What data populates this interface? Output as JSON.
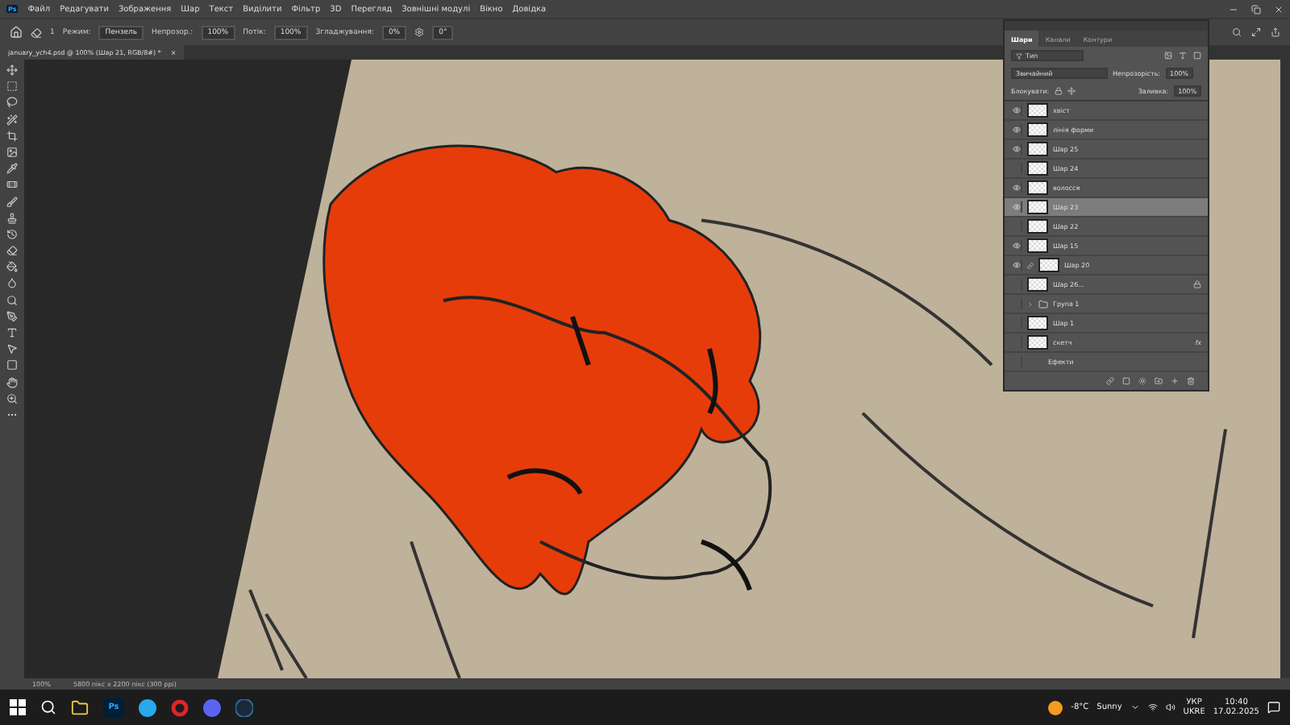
{
  "app_badge": "Ps",
  "menu": [
    "Файл",
    "Редагувати",
    "Зображення",
    "Шар",
    "Текст",
    "Виділити",
    "Фільтр",
    "3D",
    "Перегляд",
    "Зовнішні модулі",
    "Вікно",
    "Довідка"
  ],
  "options_bar": {
    "mode_label": "Режим:",
    "mode": "Пензель",
    "opacity_label": "Непрозор.:",
    "opacity": "100%",
    "flow_label": "Потік:",
    "flow": "100%",
    "smoothing_label": "Згладжування:",
    "smoothing": "0%",
    "angle": "0°",
    "brush_size": "1"
  },
  "document_tab": {
    "title": "january_ych4.psd @ 100% (Шар 21, RGB/8#) *",
    "close": "×"
  },
  "layers_panel": {
    "tabs": [
      {
        "label": "Шари",
        "selected": true
      },
      {
        "label": "Канали",
        "selected": false
      },
      {
        "label": "Контури",
        "selected": false
      }
    ],
    "filter": "Тип",
    "blend_mode": "Звичайний",
    "opacity_label": "Непрозорість:",
    "opacity": "100%",
    "lock_label": "Блокувати:",
    "fill_label": "Заливка:",
    "fill": "100%",
    "layers": [
      {
        "kind": "layer",
        "name": "хвіст",
        "visible": true,
        "selected": false,
        "locked": false
      },
      {
        "kind": "layer",
        "name": "лінія форми",
        "visible": true,
        "selected": false,
        "locked": false
      },
      {
        "kind": "layer",
        "name": "Шар 25",
        "visible": true,
        "selected": false,
        "locked": false
      },
      {
        "kind": "layer",
        "name": "Шар 24",
        "visible": false,
        "selected": false,
        "locked": false
      },
      {
        "kind": "layer",
        "name": "волосся",
        "visible": true,
        "selected": false,
        "locked": false
      },
      {
        "kind": "layer",
        "name": "Шар 23",
        "visible": true,
        "selected": true,
        "locked": false
      },
      {
        "kind": "layer",
        "name": "Шар 22",
        "visible": false,
        "selected": false,
        "locked": false
      },
      {
        "kind": "layer",
        "name": "Шар 15",
        "visible": true,
        "selected": false,
        "locked": false
      },
      {
        "kind": "clipped",
        "name": "Шар 20",
        "visible": true,
        "selected": false,
        "locked": false
      },
      {
        "kind": "layer",
        "name": "Шар 26...",
        "visible": false,
        "selected": false,
        "locked": true
      },
      {
        "kind": "group",
        "name": "Група 1",
        "visible": false,
        "selected": false,
        "locked": false
      },
      {
        "kind": "layer",
        "name": "Шар 1",
        "visible": false,
        "selected": false,
        "locked": false
      },
      {
        "kind": "layer",
        "name": "скетч",
        "visible": false,
        "selected": false,
        "locked": false,
        "badge": "fx"
      },
      {
        "kind": "effects",
        "name": "Ефекти",
        "visible": false,
        "selected": false,
        "locked": false
      }
    ]
  },
  "status_bar": {
    "zoom": "100%",
    "document_size": "5800 пікс x 2200 пікс (300 ppi)"
  },
  "taskbar": {
    "app_badge": "Ps",
    "weather": "-8°C",
    "condition": "Sunny",
    "language": "УКР",
    "layout": "UKRE",
    "time": "10:40",
    "date": "17.02.2025"
  }
}
